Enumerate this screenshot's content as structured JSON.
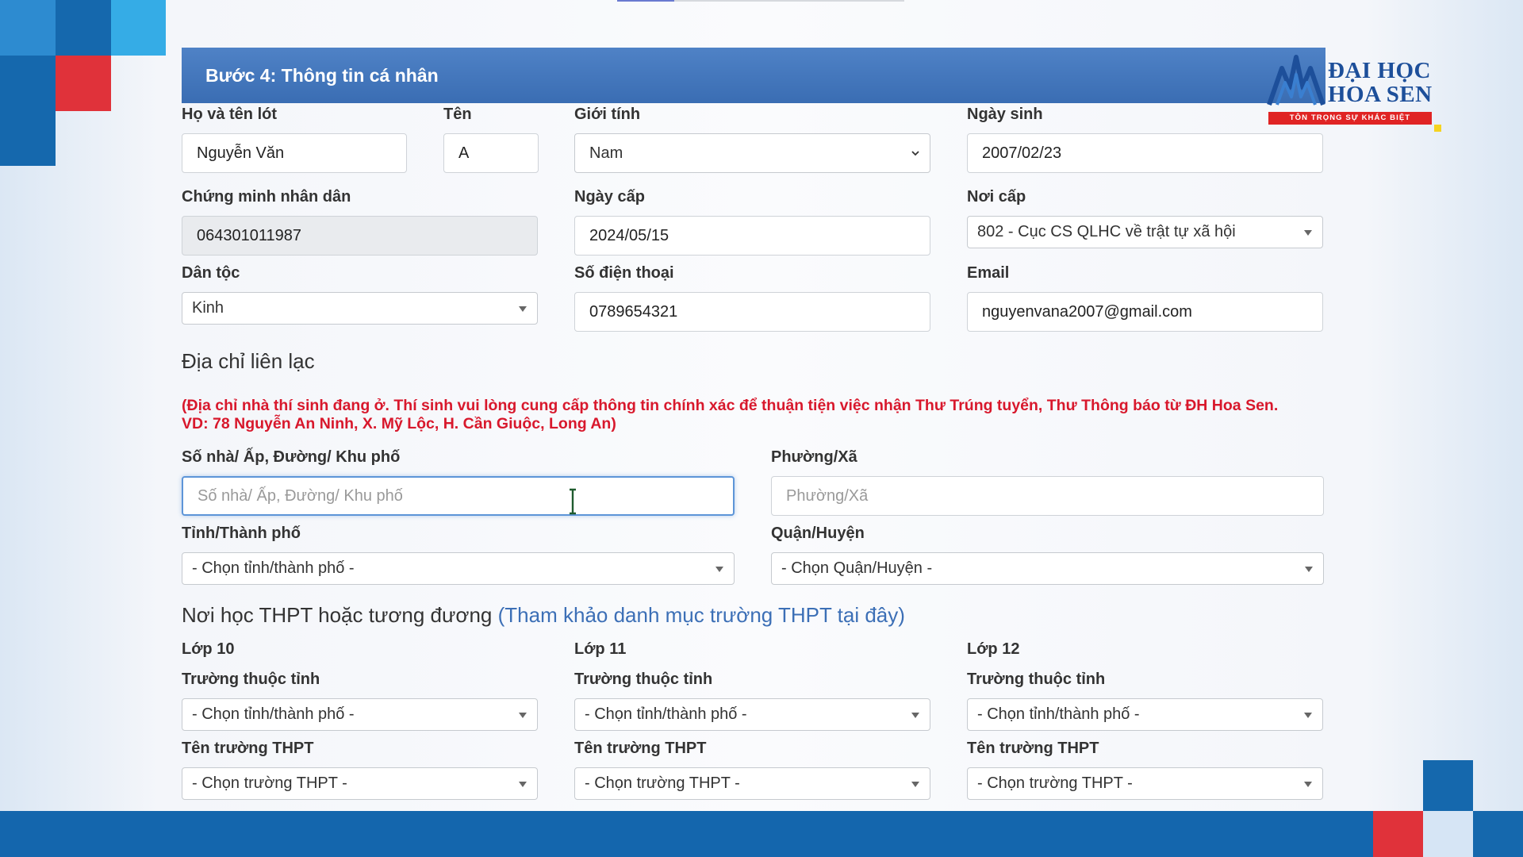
{
  "step": {
    "title": "Bước 4: Thông tin cá nhân"
  },
  "logo": {
    "line1": "ĐẠI HỌC",
    "line2": "HOA SEN",
    "tagline": "TÔN TRỌNG SỰ KHÁC BIỆT"
  },
  "personal": {
    "last_middle_label": "Họ và tên lót",
    "last_middle_value": "Nguyễn Văn",
    "first_label": "Tên",
    "first_value": "A",
    "gender_label": "Giới tính",
    "gender_value": "Nam",
    "dob_label": "Ngày sinh",
    "dob_value": "2007/02/23",
    "id_label": "Chứng minh nhân dân",
    "id_value": "064301011987",
    "issue_date_label": "Ngày cấp",
    "issue_date_value": "2024/05/15",
    "issue_place_label": "Nơi cấp",
    "issue_place_value": "802 - Cục CS QLHC về trật tự xã hội",
    "ethnicity_label": "Dân tộc",
    "ethnicity_value": "Kinh",
    "phone_label": "Số điện thoại",
    "phone_value": "0789654321",
    "email_label": "Email",
    "email_value": "nguyenvana2007@gmail.com"
  },
  "address": {
    "heading": "Địa chỉ liên lạc",
    "notice_line1": "(Địa chỉ nhà thí sinh đang ở. Thí sinh vui lòng cung cấp thông tin chính xác để thuận tiện việc nhận Thư Trúng tuyển, Thư Thông báo từ ĐH Hoa Sen.",
    "notice_line2": "VD: 78 Nguyễn An Ninh, X. Mỹ Lộc, H. Cần Giuộc, Long An)",
    "street_label": "Số nhà/ Ấp, Đường/ Khu phố",
    "street_placeholder": "Số nhà/ Ấp, Đường/ Khu phố",
    "ward_label": "Phường/Xã",
    "ward_placeholder": "Phường/Xã",
    "province_label": "Tỉnh/Thành phố",
    "province_value": "- Chọn tỉnh/thành phố -",
    "district_label": "Quận/Huyện",
    "district_value": "- Chọn Quận/Huyện -"
  },
  "school": {
    "heading": "Nơi học THPT hoặc tương đương",
    "heading_link": "(Tham khảo danh mục trường THPT tại đây)",
    "grades": [
      {
        "grade_label": "Lớp 10",
        "province_label": "Trường thuộc tỉnh",
        "province_value": "- Chọn tỉnh/thành phố -",
        "school_label": "Tên trường THPT",
        "school_value": "- Chọn trường THPT -"
      },
      {
        "grade_label": "Lớp 11",
        "province_label": "Trường thuộc tỉnh",
        "province_value": "- Chọn tỉnh/thành phố -",
        "school_label": "Tên trường THPT",
        "school_value": "- Chọn trường THPT -"
      },
      {
        "grade_label": "Lớp 12",
        "province_label": "Trường thuộc tỉnh",
        "province_value": "- Chọn tỉnh/thành phố -",
        "school_label": "Tên trường THPT",
        "school_value": "- Chọn trường THPT -"
      }
    ]
  },
  "colors": {
    "header_blue": "#3a6db3",
    "brand_blue": "#1466ad",
    "brand_red": "#e02424",
    "notice_red": "#d8182c",
    "link_blue": "#3c6fb6"
  },
  "icons": {
    "select_arrow": "caret-down-icon",
    "native_select_arrow": "chevron-down-icon",
    "text_cursor": "text-cursor-icon"
  }
}
